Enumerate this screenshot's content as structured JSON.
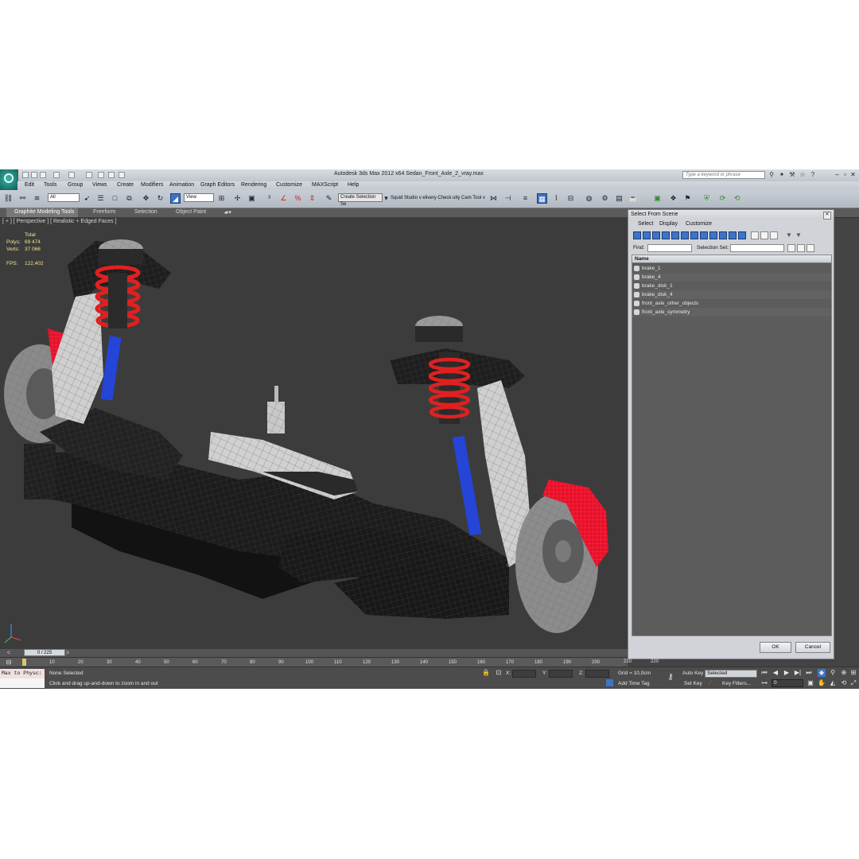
{
  "window": {
    "title": "Autodesk 3ds Max  2012 x64      Sedan_Front_Axle_2_vray.max",
    "help_search_placeholder": "Type a keyword or phrase"
  },
  "menu": [
    "Edit",
    "Tools",
    "Group",
    "Views",
    "Create",
    "Modifiers",
    "Animation",
    "Graph Editors",
    "Rendering",
    "Customize",
    "MAXScript",
    "Help"
  ],
  "toolbar": {
    "selection_filter": "All",
    "reference_coord": "View",
    "selection_set": "Create Selection Se",
    "plugin_text": "Squid Studio v elivery Check   ulty Cam Tool v"
  },
  "ribbon": {
    "tabs": [
      "Graphite Modeling Tools",
      "Freeform",
      "Selection",
      "Object Paint"
    ]
  },
  "viewport": {
    "label": "[ + ] [ Perspective ] [ Realistic + Edged Faces ]",
    "stats": {
      "total_label": "Total",
      "polys_label": "Polys:",
      "polys": "69 474",
      "verts_label": "Verts:",
      "verts": "37 066",
      "fps_label": "FPS:",
      "fps": "122,402"
    }
  },
  "dialog": {
    "title": "Select From Scene",
    "menu": [
      "Select",
      "Display",
      "Customize"
    ],
    "find_label": "Find:",
    "selection_set_label": "Selection Set:",
    "column_name": "Name",
    "items": [
      "brake_1",
      "brake_4",
      "brake_disk_1",
      "brake_disk_4",
      "front_axle_other_objects",
      "front_axle_symmetry"
    ],
    "ok": "OK",
    "cancel": "Cancel"
  },
  "timeline": {
    "frame": "0 / 225",
    "ticks": [
      "10",
      "20",
      "30",
      "40",
      "50",
      "60",
      "70",
      "80",
      "90",
      "100",
      "110",
      "120",
      "130",
      "140",
      "150",
      "160",
      "170",
      "180",
      "190",
      "200",
      "210",
      "220"
    ]
  },
  "status": {
    "maxscript": "Max to Physc:",
    "selection": "None Selected",
    "prompt": "Click and drag up-and-down to zoom in and out",
    "x_label": "X:",
    "y_label": "Y:",
    "z_label": "Z:",
    "grid": "Grid = 10,0cm",
    "add_time_tag": "Add Time Tag",
    "auto_key": "Auto Key",
    "auto_key_mode": "Selected",
    "set_key": "Set Key",
    "key_filters": "Key Filters...",
    "current_frame": "0"
  },
  "colors": {
    "spring": "#e02020",
    "shock": "#2445d8",
    "caliper": "#e8102a",
    "accent": "#3e74c8"
  }
}
